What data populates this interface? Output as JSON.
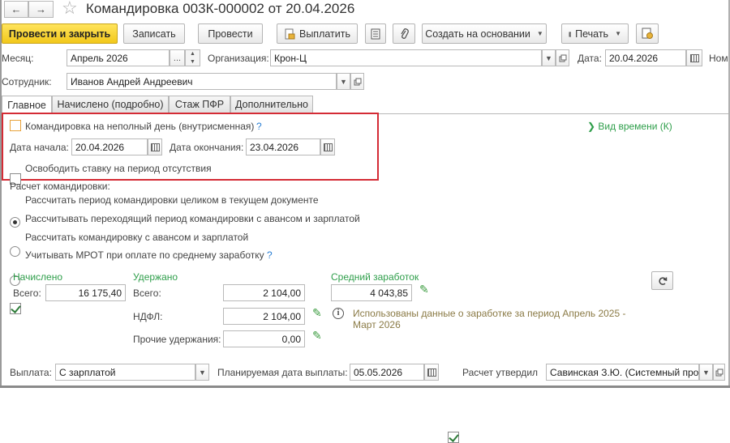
{
  "window": {
    "title": "Командировка 003К-000002 от 20.04.2026",
    "back_icon": "←",
    "forward_icon": "→",
    "star_icon": "☆"
  },
  "toolbar": {
    "post_and_close": "Провести и закрыть",
    "save": "Записать",
    "post": "Провести",
    "pay": "Выплатить",
    "create_based_on": "Создать на основании",
    "print": "Печать"
  },
  "header": {
    "month_label": "Месяц:",
    "month_value": "Апрель 2026",
    "month_pick": "...",
    "org_label": "Организация:",
    "org_value": "Крон-Ц",
    "date_label": "Дата:",
    "date_value": "20.04.2026",
    "number_label": "Ном",
    "employee_label": "Сотрудник:",
    "employee_value": "Иванов Андрей Андреевич"
  },
  "tabs": [
    "Главное",
    "Начислено (подробно)",
    "Стаж ПФР",
    "Дополнительно"
  ],
  "main": {
    "partial_day_label": "Командировка на неполный день (внутрисменная)",
    "help_mark": "?",
    "time_kind_link": "Вид времени (К)",
    "start_label": "Дата начала:",
    "start_value": "20.04.2026",
    "end_label": "Дата окончания:",
    "end_value": "23.04.2026",
    "free_rate_label": "Освободить ставку на период отсутствия",
    "calc_title": "Расчет командировки:",
    "radio_options": [
      "Рассчитать период командировки целиком в текущем документе",
      "Рассчитывать переходящий период командировки с авансом и зарплатой",
      "Рассчитать командировку с авансом и зарплатой"
    ],
    "mrot_label": "Учитывать МРОТ при оплате по среднему заработку"
  },
  "totals": {
    "accrued_title": "Начислено",
    "accrued_total_label": "Всего:",
    "accrued_total_value": "16 175,40",
    "withheld_title": "Удержано",
    "withheld_total_label": "Всего:",
    "withheld_total_value": "2 104,00",
    "ndfl_label": "НДФЛ:",
    "ndfl_value": "2 104,00",
    "other_label": "Прочие удержания:",
    "other_value": "0,00",
    "avg_title": "Средний заработок",
    "avg_value": "4 043,85",
    "info_text": "Использованы данные о заработке за период Апрель 2025 - Март 2026",
    "info_icon": "i"
  },
  "footer": {
    "payment_label": "Выплата:",
    "payment_value": "С зарплатой",
    "planned_label": "Планируемая дата выплаты:",
    "planned_value": "05.05.2026",
    "approved_label": "Расчет утвердил",
    "approved_value": "Савинская З.Ю. (Системный прог"
  }
}
